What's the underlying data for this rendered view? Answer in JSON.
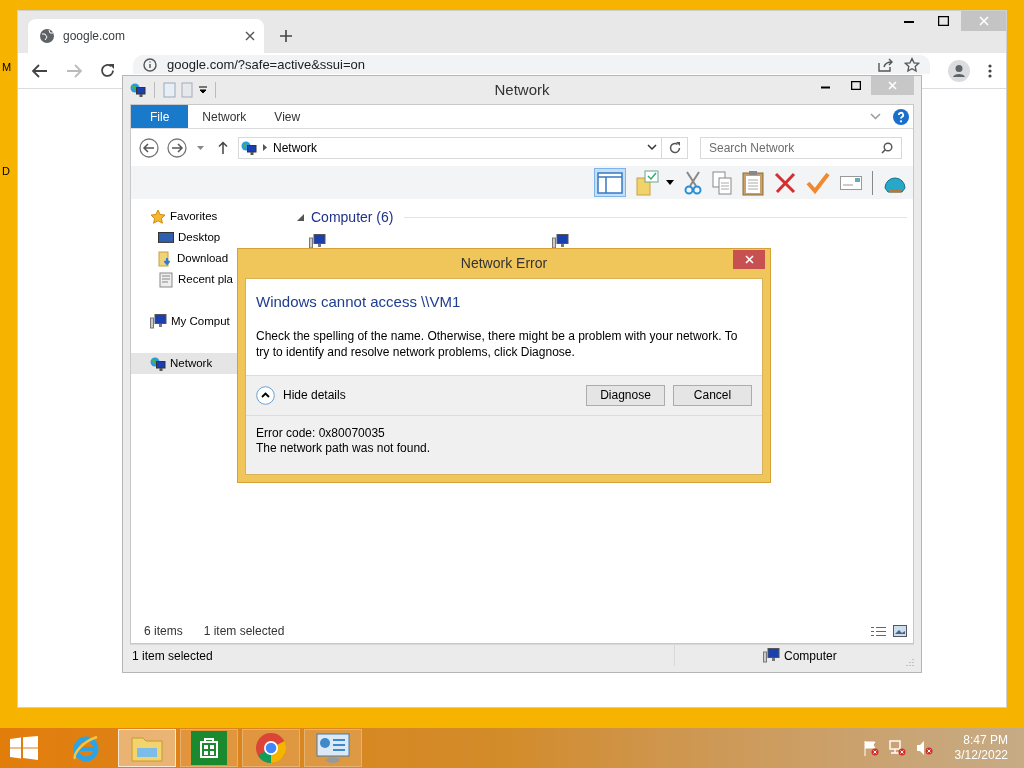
{
  "desktop_icons": [
    {
      "label": "M"
    },
    {
      "label": "D"
    }
  ],
  "browser": {
    "tabs": [
      {
        "title": "google.com",
        "selected": true
      }
    ],
    "address": "google.com/?safe=active&ssui=on"
  },
  "explorer": {
    "title": "Network",
    "ribbon_tabs": [
      {
        "label": "File",
        "selected": true
      },
      {
        "label": "Network",
        "selected": false
      },
      {
        "label": "View",
        "selected": false
      }
    ],
    "breadcrumb": [
      "Network"
    ],
    "search": {
      "placeholder": "Search Network"
    },
    "toolbar": {
      "layout_pane_selected": true
    },
    "nav": [
      {
        "label": "Favorites",
        "kind": "star",
        "selected": false,
        "children": [
          {
            "label": "Desktop",
            "kind": "desktop",
            "selected": false
          },
          {
            "label": "Download",
            "kind": "downloads",
            "selected": false
          },
          {
            "label": "Recent pla",
            "kind": "recent",
            "selected": false
          }
        ]
      },
      {
        "label": "My Comput",
        "kind": "computer",
        "selected": false
      },
      {
        "label": "Network",
        "kind": "network",
        "selected": true
      }
    ],
    "group": {
      "label": "Computer (6)",
      "expanded": true
    },
    "item_counts": [
      "6 items",
      "1 item selected"
    ],
    "status_bar": {
      "text": "1 item selected",
      "location": "Computer"
    }
  },
  "dialog": {
    "title": "Network Error",
    "heading": "Windows cannot access \\\\VM1",
    "message": "Check the spelling of the name. Otherwise, there might be a problem with your network. To try to identify and resolve network problems, click Diagnose.",
    "details_toggle": {
      "label": "Hide details",
      "expanded": true
    },
    "buttons": [
      "Diagnose",
      "Cancel"
    ],
    "details": [
      "Error code: 0x80070035",
      "The network path was not found."
    ]
  },
  "taskbar": {
    "apps": [
      {
        "kind": "ie",
        "selected": false
      },
      {
        "kind": "explorer",
        "selected": true
      },
      {
        "kind": "store",
        "selected": false
      },
      {
        "kind": "chrome",
        "selected": false
      },
      {
        "kind": "control-panel",
        "selected": false
      }
    ],
    "time": "8:47 PM",
    "date": "3/12/2022"
  }
}
